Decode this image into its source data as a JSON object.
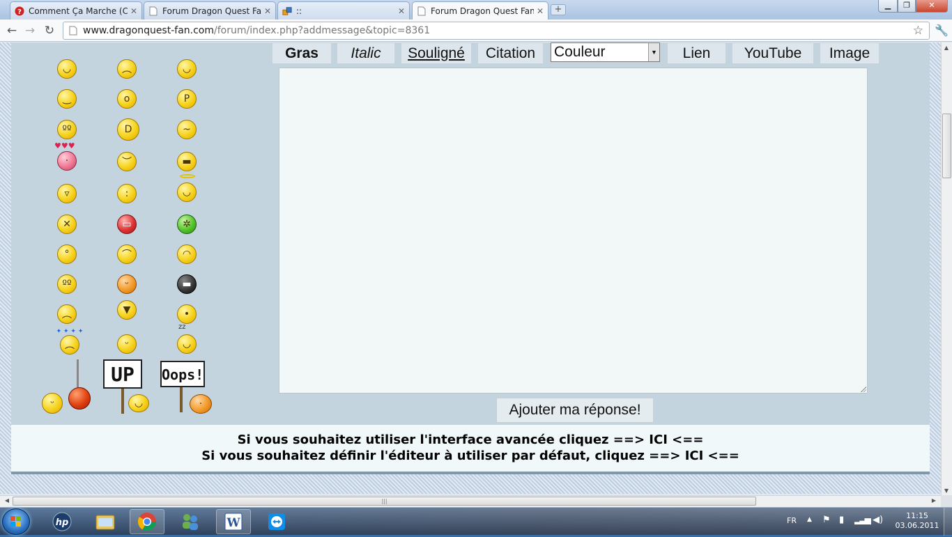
{
  "browser": {
    "tabs": [
      {
        "title": "Comment Ça Marche (C...",
        "favicon": "ccm-red-question-icon"
      },
      {
        "title": "Forum Dragon Quest Fan...",
        "favicon": "page-icon"
      },
      {
        "title": "::",
        "favicon": "puzzle-icon"
      },
      {
        "title": "Forum Dragon Quest Fan",
        "favicon": "page-icon",
        "active": true
      }
    ],
    "url_host": "www.dragonquest-fan.com",
    "url_path": "/forum/index.php?addmessage&topic=8361"
  },
  "smileys": {
    "signs": [
      "UP",
      "Oops!"
    ],
    "rows": [
      [
        "smile",
        "frown",
        "wink-smile"
      ],
      [
        "grin-closed",
        "surprised",
        "tongue"
      ],
      [
        "rolling-eyes",
        "big-laugh",
        "confused"
      ],
      [
        "in-love",
        "angry",
        "cool-sunglasses"
      ],
      [
        "happy",
        "neutral",
        "angel"
      ],
      [
        "dead",
        "mad-red",
        "sick-green"
      ],
      [
        "whistle",
        "sleepy",
        "laughing"
      ],
      [
        "shocked",
        "embarrassed",
        "ninja"
      ],
      [
        "crying",
        "drooling",
        "raised-eyebrow"
      ],
      [
        "dizzy",
        "pleased",
        "sleeping"
      ]
    ]
  },
  "editor": {
    "buttons": {
      "bold": "Gras",
      "italic": "Italic",
      "underline": "Souligné",
      "quote": "Citation",
      "link": "Lien",
      "youtube": "YouTube",
      "image": "Image"
    },
    "color_select": "Couleur",
    "message": "",
    "submit": "Ajouter ma réponse!"
  },
  "info": {
    "line1": "Si vous souhaitez utiliser l'interface avancée cliquez ==> ICI <==",
    "line2": "Si vous souhaitez définir l'éditeur à utiliser par défaut, cliquez ==> ICI <=="
  },
  "taskbar": {
    "language": "FR",
    "time": "11:15",
    "date": "03.06.2011",
    "apps": [
      "hp-icon",
      "explorer-icon",
      "chrome-icon",
      "users-icon",
      "word-icon",
      "teamviewer-icon"
    ]
  },
  "colors": {
    "page_bg": "#c4d4de",
    "textarea_bg": "#f2f8f8",
    "button_bg": "#dde6ec",
    "info_bg": "#f1f8f9"
  }
}
